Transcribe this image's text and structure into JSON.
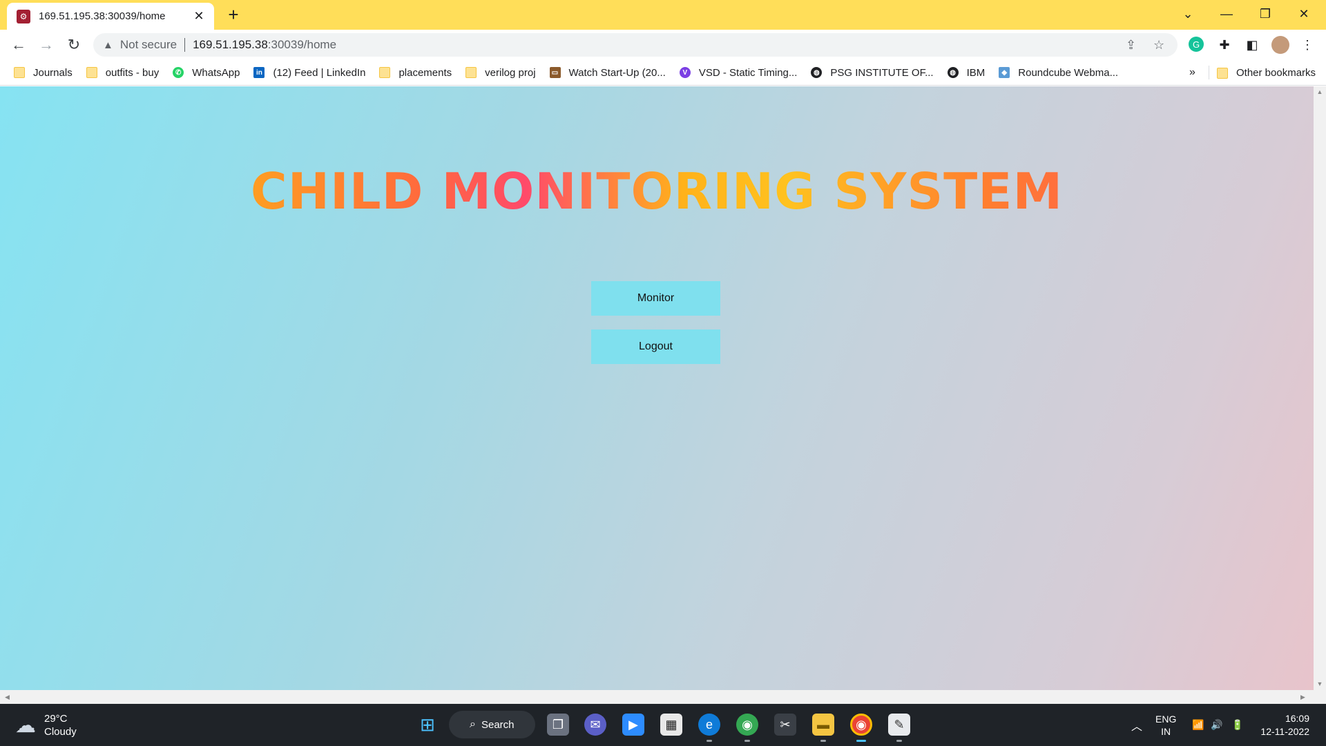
{
  "browser": {
    "tab_title": "169.51.195.38:30039/home",
    "tab_close_glyph": "✕",
    "new_tab_glyph": "+",
    "security_label": "Not secure",
    "url_host": "169.51.195.38",
    "url_path": ":30039/home"
  },
  "bookmarks": {
    "items": [
      {
        "label": "Journals",
        "icon": "folder-icon"
      },
      {
        "label": "outfits - buy",
        "icon": "folder-icon"
      },
      {
        "label": "WhatsApp",
        "icon": "whatsapp-icon"
      },
      {
        "label": "(12) Feed | LinkedIn",
        "icon": "linkedin-icon"
      },
      {
        "label": "placements",
        "icon": "folder-icon"
      },
      {
        "label": "verilog proj",
        "icon": "folder-icon"
      },
      {
        "label": "Watch Start-Up (20...",
        "icon": "tv-icon"
      },
      {
        "label": "VSD - Static Timing...",
        "icon": "vsd-icon"
      },
      {
        "label": "PSG INSTITUTE OF...",
        "icon": "globe-icon"
      },
      {
        "label": "IBM",
        "icon": "globe-icon"
      },
      {
        "label": "Roundcube Webma...",
        "icon": "roundcube-icon"
      }
    ],
    "more": "»",
    "other": "Other bookmarks"
  },
  "page": {
    "title": "CHILD MONITORING SYSTEM",
    "monitor_button": "Monitor",
    "logout_button": "Logout"
  },
  "taskbar": {
    "temperature": "29°C",
    "condition": "Cloudy",
    "search_label": "Search",
    "lang_line1": "ENG",
    "lang_line2": "IN",
    "time": "16:09",
    "date": "12-11-2022"
  },
  "colors": {
    "title_bar": "#ffde59",
    "page_bg_start": "#86e3f2",
    "page_bg_end": "#e8c4cb",
    "button_bg": "#7fe0ee"
  }
}
